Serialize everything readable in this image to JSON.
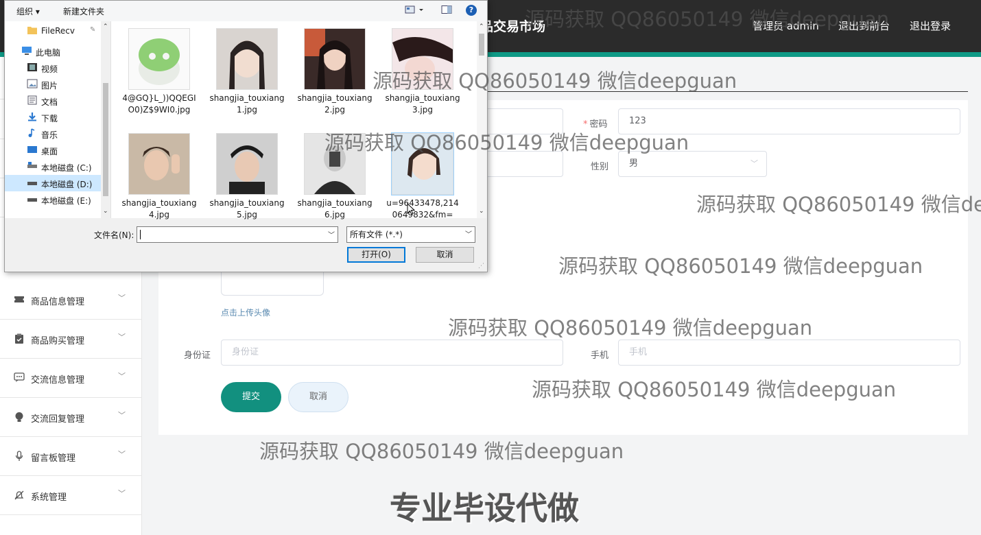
{
  "header": {
    "app_title": "品交易市场",
    "admin_label": "管理员 admin",
    "to_front_label": "退出到前台",
    "logout_label": "退出登录"
  },
  "sidebar": {
    "items": [
      {
        "label": "商品信息管理",
        "icon": "ticket-icon"
      },
      {
        "label": "商品购买管理",
        "icon": "clipboard-icon"
      },
      {
        "label": "交流信息管理",
        "icon": "chat-icon"
      },
      {
        "label": "交流回复管理",
        "icon": "bulb-icon"
      },
      {
        "label": "留言板管理",
        "icon": "microphone-icon"
      },
      {
        "label": "系统管理",
        "icon": "bell-off-icon"
      }
    ]
  },
  "form": {
    "password_label": "密码",
    "password_value": "123",
    "gender_label": "性别",
    "gender_value": "男",
    "upload_tip": "点击上传头像",
    "id_card_label": "身份证",
    "id_card_placeholder": "身份证",
    "phone_label": "手机",
    "phone_placeholder": "手机",
    "submit_label": "提交",
    "cancel_label": "取消"
  },
  "dialog": {
    "toolbar": {
      "organize_label": "组织 ▾",
      "new_folder_label": "新建文件夹",
      "help_label": "?"
    },
    "nav_items": [
      {
        "label": "FileRecv",
        "icon": "folder-icon"
      },
      {
        "label": "此电脑",
        "icon": "computer-icon"
      },
      {
        "label": "视频",
        "icon": "video-icon"
      },
      {
        "label": "图片",
        "icon": "picture-icon"
      },
      {
        "label": "文档",
        "icon": "document-icon"
      },
      {
        "label": "下载",
        "icon": "download-icon"
      },
      {
        "label": "音乐",
        "icon": "music-icon"
      },
      {
        "label": "桌面",
        "icon": "desktop-icon"
      },
      {
        "label": "本地磁盘 (C:)",
        "icon": "drive-icon"
      },
      {
        "label": "本地磁盘 (D:)",
        "icon": "drive-icon"
      },
      {
        "label": "本地磁盘 (E:)",
        "icon": "drive-icon"
      }
    ],
    "files": [
      {
        "name": "4@GQ}L_))QQEGIO0)Z$9WI0.jpg"
      },
      {
        "name": "shangjia_touxiang1.jpg"
      },
      {
        "name": "shangjia_touxiang2.jpg"
      },
      {
        "name": "shangjia_touxiang3.jpg"
      },
      {
        "name": "shangjia_touxiang4.jpg"
      },
      {
        "name": "shangjia_touxiang5.jpg"
      },
      {
        "name": "shangjia_touxiang6.jpg"
      },
      {
        "name": "u=96433478,2140649832&fm="
      }
    ],
    "filename_label": "文件名(N):",
    "filename_value": "",
    "filetype_value": "所有文件 (*.*)",
    "open_label": "打开(O)",
    "cancel_label": "取消"
  },
  "watermarks": {
    "text": "源码获取 QQ86050149 微信deepguan",
    "bottom_text": "专业毕设代做"
  },
  "colors": {
    "header_bg": "#2b2b2b",
    "accent": "#0f9a86",
    "submit_bg": "#12907f"
  }
}
